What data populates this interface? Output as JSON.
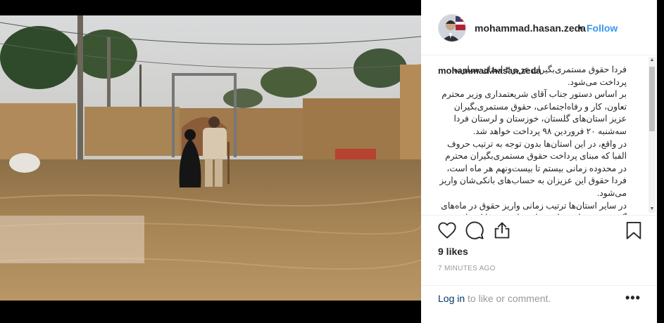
{
  "post": {
    "username": "mohammad.hasan.zeda",
    "follow_label": "Follow",
    "separator": "•",
    "caption": "فردا حقوق مستمری‌بگیران عزیز ۳ استان سیلزده پرداخت می‌شود.\nبر اساس دستور جناب آقای شریعتمداری وزیر محترم تعاون، کار و رفاه‌اجتماعی، حقوق مستمری‌بگیران عزیز استان‌های گلستان، خوزستان و لرستان فردا سه‌شنبه ۲۰ فروردین ۹۸ پرداخت خواهد شد.\nدر واقع، در این استان‌ها بدون توجه به ترتیب حروف الفبا که مبنای پرداخت حقوق مستمری‌بگیران محترم در محدوده زمانی بیستم تا بیست‌ونهم هر ماه است، فردا حقوق این عزیزان به حساب‌های بانکی‌شان واریز می‌شود.\nدر سایر استان‌ها ترتیب زمانی واریز حقوق در ماه‌های گذشته، همچنان مبنای عمل خواهد بود. با احترام و ارادت.",
    "likes": "9 likes",
    "time_ago": "7 MINUTES AGO"
  },
  "footer": {
    "login_link": "Log in",
    "login_rest": " to like or comment.",
    "more_label": "•••"
  },
  "icons": [
    "heart-icon",
    "comment-icon",
    "share-icon",
    "bookmark-icon"
  ],
  "colors": {
    "link": "#3897f0",
    "text": "#262626",
    "muted": "#999999",
    "login_link": "#003569"
  }
}
